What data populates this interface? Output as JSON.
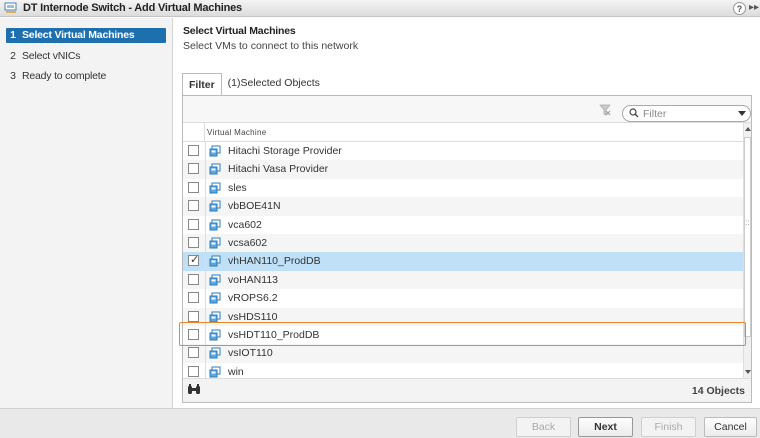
{
  "window": {
    "title": "DT Internode Switch - Add Virtual Machines",
    "help_label": "?",
    "expand_label": "▸▸"
  },
  "steps": [
    {
      "num": "1",
      "label": "Select Virtual Machines",
      "active": true
    },
    {
      "num": "2",
      "label": "Select vNICs",
      "active": false
    },
    {
      "num": "3",
      "label": "Ready to complete",
      "active": false
    }
  ],
  "main": {
    "title": "Select Virtual Machines",
    "subtitle": "Select VMs to connect to this network"
  },
  "tabs": [
    {
      "label": "Filter",
      "active": true
    },
    {
      "label": "(1)Selected Objects",
      "active": false
    }
  ],
  "filter": {
    "placeholder": "Filter",
    "value": ""
  },
  "grid": {
    "column_header": "Virtual Machine",
    "rows": [
      {
        "name": "Hitachi Storage Provider",
        "checked": false
      },
      {
        "name": "Hitachi Vasa Provider",
        "checked": false
      },
      {
        "name": "sles",
        "checked": false
      },
      {
        "name": "vbBOE41N",
        "checked": false
      },
      {
        "name": "vca602",
        "checked": false
      },
      {
        "name": "vcsa602",
        "checked": false
      },
      {
        "name": "vhHAN110_ProdDB",
        "checked": true
      },
      {
        "name": "voHAN113",
        "checked": false
      },
      {
        "name": "vROPS6.2",
        "checked": false
      },
      {
        "name": "vsHDS110",
        "checked": false
      },
      {
        "name": "vsHDT110_ProdDB",
        "checked": false
      },
      {
        "name": "vsIOT110",
        "checked": false
      },
      {
        "name": "win",
        "checked": false
      }
    ],
    "count_label": "14 Objects"
  },
  "buttons": {
    "back": "Back",
    "next": "Next",
    "finish": "Finish",
    "cancel": "Cancel"
  },
  "colors": {
    "accent": "#1e6fad",
    "selected_row": "#bfe0f6",
    "highlight": "#e8882d"
  }
}
